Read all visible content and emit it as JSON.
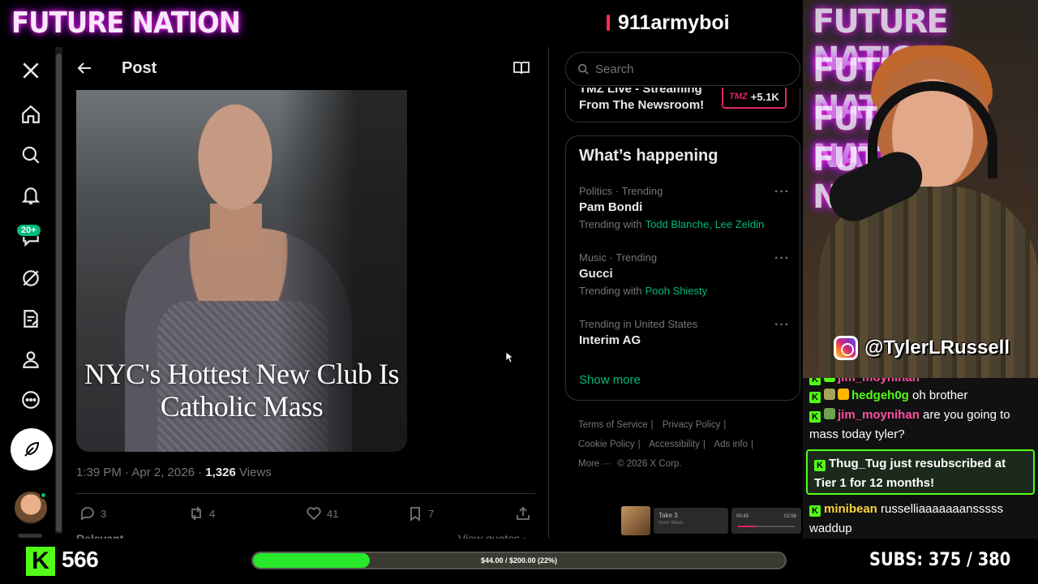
{
  "stream": {
    "logo": "FUTURE NATION",
    "streamer": "911armyboi",
    "cam_logo_lines": [
      "FUTURE NATION",
      "FUTURE NATION",
      "FUTURE NATION",
      "FUTURE NATION"
    ],
    "instagram_handle": "@TylerLRussell",
    "followers": "566",
    "goal_text": "$44.00 / $200.00 (22%)",
    "goal_progress": 0.22,
    "subs_text": "SUBS:  375 / 380"
  },
  "nav": {
    "icons": [
      "x-logo-icon",
      "home-icon",
      "search-icon",
      "notifications-icon",
      "messages-icon",
      "grok-icon",
      "drafts-icon",
      "profile-icon",
      "more-icon"
    ],
    "messages_badge": "20+"
  },
  "post": {
    "header_title": "Post",
    "headline": "NYC's Hottest New Club Is Catholic Mass",
    "timestamp": "1:39 PM · Apr 2, 2026 · ",
    "views_count": "1,326",
    "views_label": " Views",
    "actions": {
      "replies": "3",
      "reposts": "4",
      "likes": "41",
      "bookmarks": "7"
    },
    "relevant_label": "Relevant",
    "quotes_label": "View quotes ›"
  },
  "sidebar": {
    "search_placeholder": "Search",
    "live": {
      "title": "TMZ Live - Streaming From The Newsroom!",
      "badge_brand": "TMZ",
      "badge_count": "+5.1K"
    },
    "happening_title": "What’s happening",
    "trends": [
      {
        "category": "Politics · Trending",
        "name": "Pam Bondi",
        "with_label": "Trending with",
        "with": "Todd Blanche, Lee Zeldin"
      },
      {
        "category": "Music · Trending",
        "name": "Gucci",
        "with_label": "Trending with",
        "with": "Pooh Shiesty"
      },
      {
        "category": "Trending in United States",
        "name": "Interim AG",
        "with_label": "",
        "with": ""
      }
    ],
    "show_more": "Show more",
    "footer": {
      "terms": "Terms of Service",
      "privacy": "Privacy Policy",
      "cookie": "Cookie Policy",
      "accessibility": "Accessibility",
      "ads": "Ads info",
      "more": "More ···",
      "copyright": "© 2026 X Corp."
    }
  },
  "player": {
    "track": "Take 3",
    "artist": "Inner Wave",
    "elapsed": "00:45",
    "total": "02:56"
  },
  "chat": {
    "top_cut": "jim_moynihan",
    "messages": [
      {
        "user": "hedgeh0g",
        "text": "oh brother"
      },
      {
        "user": "jim_moynihan",
        "text": "are you going to mass today tyler?"
      }
    ],
    "sub_notice": "Thug_Tug just resubscribed at Tier 1 for 12 months!",
    "last_message": {
      "user": "minibean",
      "text": "russelliaaaaaaansssss waddup"
    }
  },
  "colors": {
    "x_green_accent": "#00ba7c",
    "kick_green": "#53fc18",
    "tmz_red": "#e0245e"
  }
}
